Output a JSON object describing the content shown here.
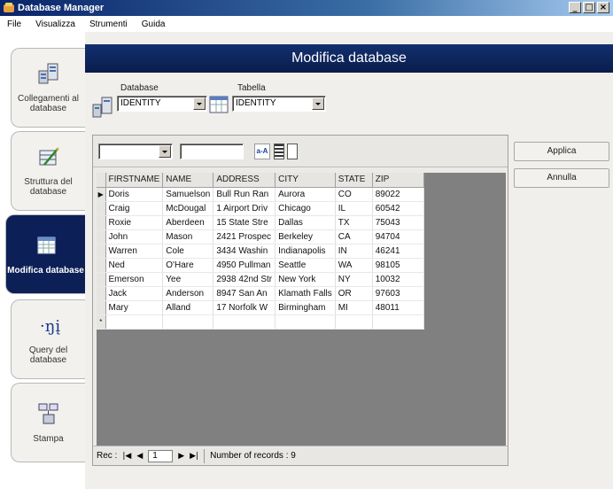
{
  "window": {
    "title": "Database Manager",
    "controls": [
      "_",
      "□",
      "×"
    ]
  },
  "menu": [
    "File",
    "Visualizza",
    "Strumenti",
    "Guida"
  ],
  "sidebar": {
    "items": [
      {
        "label": "Collegamenti al database",
        "icon": "database-connection-icon"
      },
      {
        "label": "Struttura del database",
        "icon": "database-structure-icon"
      },
      {
        "label": "Modifica database",
        "icon": "edit-database-icon",
        "active": true
      },
      {
        "label": "Query del database",
        "icon": "query-icon"
      },
      {
        "label": "Stampa",
        "icon": "print-icon"
      }
    ]
  },
  "banner": {
    "title": "Modifica database"
  },
  "selectors": {
    "database_label": "Database",
    "database_value": "IDENTITY",
    "table_label": "Tabella",
    "table_value": "IDENTITY"
  },
  "toolbar": {
    "filter_field": "",
    "filter_value": "",
    "sort_icon": "a-z-sort-icon"
  },
  "grid": {
    "columns": [
      "FIRSTNAME",
      "NAME",
      "ADDRESS",
      "CITY",
      "STATE",
      "ZIP"
    ],
    "rows": [
      [
        "Doris",
        "Samuelson",
        "Bull Run Ran",
        "Aurora",
        "CO",
        "89022"
      ],
      [
        "Craig",
        "McDougal",
        "1 Airport Driv",
        "Chicago",
        "IL",
        "60542"
      ],
      [
        "Roxie",
        "Aberdeen",
        "15 State Stre",
        "Dallas",
        "TX",
        "75043"
      ],
      [
        "John",
        "Mason",
        "2421 Prospec",
        "Berkeley",
        "CA",
        "94704"
      ],
      [
        "Warren",
        "Cole",
        "3434 Washin",
        "Indianapolis",
        "IN",
        "46241"
      ],
      [
        "Ned",
        "O'Hare",
        "4950 Pullman",
        "Seattle",
        "WA",
        "98105"
      ],
      [
        "Emerson",
        "Yee",
        "2938 42nd Str",
        "New York",
        "NY",
        "10032"
      ],
      [
        "Jack",
        "Anderson",
        "8947 San An",
        "Klamath Falls",
        "OR",
        "97603"
      ],
      [
        "Mary",
        "Alland",
        "17 Norfolk W",
        "Birmingham",
        "MI",
        "48011"
      ]
    ],
    "current_row_marker": "▶",
    "new_row_marker": "*"
  },
  "status": {
    "rec_label": "Rec :",
    "rec_value": "1",
    "record_count": "Number of records : 9"
  },
  "actions": {
    "apply": "Applica",
    "cancel": "Annulla"
  }
}
